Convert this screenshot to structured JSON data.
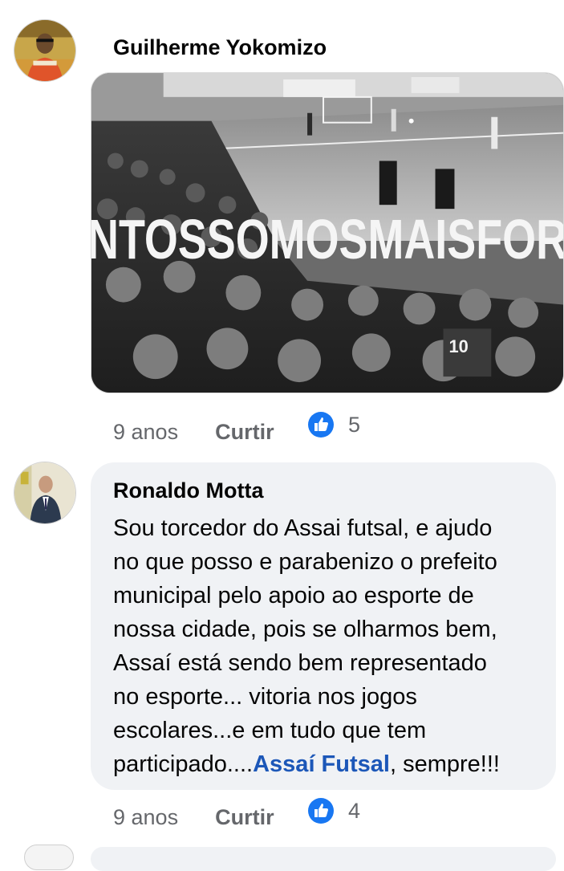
{
  "comments": [
    {
      "author": "Guilherme Yokomizo",
      "image_text": "NTOSSOMOSMAISFOR",
      "jersey_number": "10",
      "time": "9 anos",
      "like_label": "Curtir",
      "reaction_icon": "like-thumb-icon",
      "reaction_count": "5"
    },
    {
      "author": "Ronaldo Motta",
      "text_lines": [
        "Sou torcedor do Assai futsal, e ajudo",
        "no que posso e parabenizo o prefeito",
        "municipal pelo apoio ao esporte de",
        "nossa cidade, pois se olharmos bem,",
        "Assaí está sendo bem representado",
        "no esporte... vitoria nos jogos",
        "escolares...e em tudo que tem"
      ],
      "last_line_prefix": "participado....",
      "mention": "Assaí Futsal",
      "last_line_suffix": ", sempre!!!",
      "time": "9 anos",
      "like_label": "Curtir",
      "reaction_icon": "like-thumb-icon",
      "reaction_count": "4"
    }
  ],
  "colors": {
    "background": "#ffffff",
    "bubble": "#f0f2f5",
    "meta_text": "#65676b",
    "link": "#1c57b8",
    "like_blue": "#1877f2"
  }
}
